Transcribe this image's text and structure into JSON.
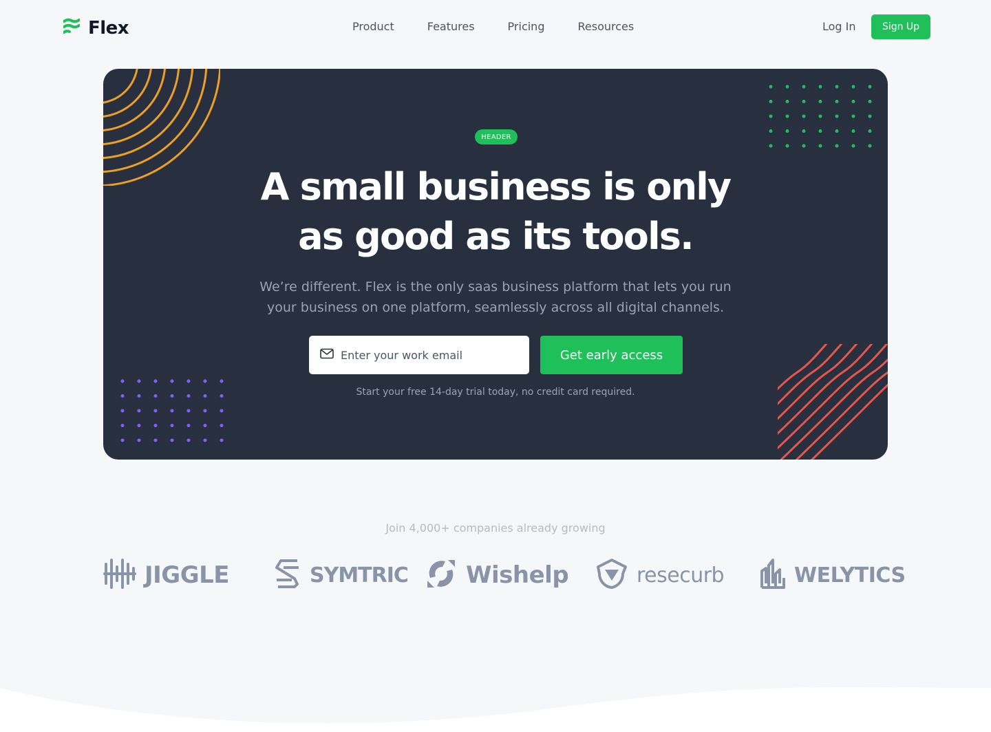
{
  "nav": {
    "brand": "Flex",
    "links": [
      "Product",
      "Features",
      "Pricing",
      "Resources"
    ],
    "login": "Log In",
    "signup": "Sign Up"
  },
  "hero": {
    "badge": "HEADER",
    "headline_line1": "A small business is only",
    "headline_line2": "as good as its tools.",
    "subtext": "We’re different. Flex is the only saas business platform that lets you run your business on one platform, seamlessly across all digital channels.",
    "email_placeholder": "Enter your work email",
    "cta": "Get early access",
    "trial_note": "Start your free 14-day trial today, no credit card required."
  },
  "social_proof": {
    "heading": "Join 4,000+ companies already growing",
    "brands": [
      "JIGGLE",
      "SYMTRIC",
      "Wishelp",
      "resecurb",
      "WELYTICS"
    ]
  },
  "colors": {
    "accent": "#1fbf5a",
    "hero_bg": "#28303f",
    "orange": "#f0a020",
    "red": "#e8564a",
    "purple": "#8b5cf6",
    "logo_gray": "#8a94a8"
  },
  "icons": [
    "flex-logo-icon",
    "mail-icon",
    "jiggle-logo-icon",
    "symtric-logo-icon",
    "wishelp-logo-icon",
    "resecurb-logo-icon",
    "welytics-logo-icon"
  ]
}
